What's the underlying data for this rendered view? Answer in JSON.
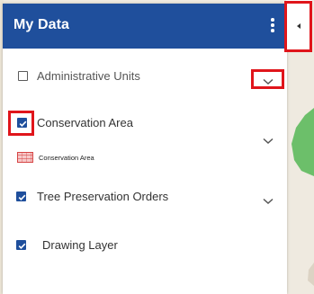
{
  "panel": {
    "title": "My Data",
    "menu_icon": "kebab-menu-icon",
    "header_color": "#1f4f9c"
  },
  "collapse_tab": {
    "icon": "caret-left-icon"
  },
  "layers": [
    {
      "label": "Administrative Units",
      "checked": false,
      "expand_icon": "chevron-down-icon"
    },
    {
      "label": "Conservation Area",
      "checked": true,
      "expand_icon": "chevron-down-icon",
      "legend": {
        "label": "Conservation Area",
        "swatch_icon": "hatched-red-swatch-icon",
        "swatch_color": "#d64545"
      }
    },
    {
      "label": "Tree Preservation Orders",
      "checked": true,
      "expand_icon": "chevron-down-icon"
    },
    {
      "label": "Drawing Layer",
      "checked": true
    }
  ],
  "highlight_color": "#e0151b",
  "map_green": "#6cbf6a"
}
